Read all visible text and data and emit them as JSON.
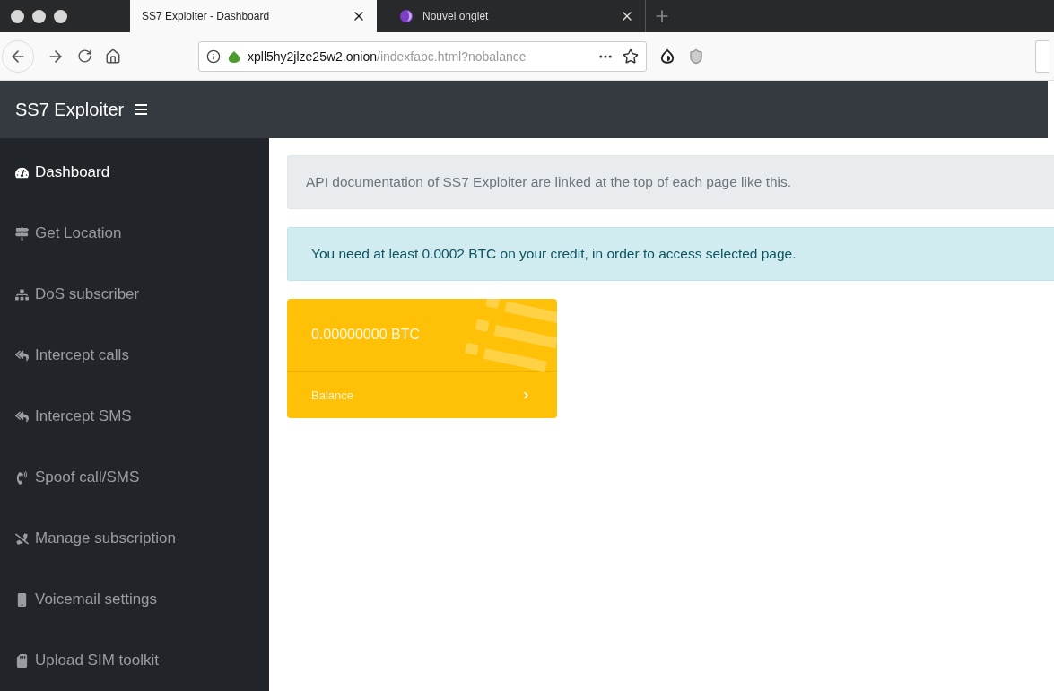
{
  "browser": {
    "tabs": [
      {
        "title": "SS7 Exploiter - Dashboard",
        "selected": true
      },
      {
        "title": "Nouvel onglet",
        "selected": false
      }
    ],
    "url": {
      "host": "xpll5hy2jlze25w2.onion",
      "path": "/indexfabc.html?nobalance"
    }
  },
  "navbar": {
    "brand": "SS7 Exploiter"
  },
  "sidebar": {
    "items": [
      {
        "label": "Dashboard",
        "selected": true
      },
      {
        "label": "Get Location",
        "selected": false
      },
      {
        "label": "DoS subscriber",
        "selected": false
      },
      {
        "label": "Intercept calls",
        "selected": false
      },
      {
        "label": "Intercept SMS",
        "selected": false
      },
      {
        "label": "Spoof call/SMS",
        "selected": false
      },
      {
        "label": "Manage subscription",
        "selected": false
      },
      {
        "label": "Voicemail settings",
        "selected": false
      },
      {
        "label": "Upload SIM toolkit",
        "selected": false
      }
    ]
  },
  "alerts": [
    {
      "kind": "secondary",
      "text": "API documentation of SS7 Exploiter are linked at the top of each page like this."
    },
    {
      "kind": "info",
      "text": "You need at least 0.0002 BTC on your credit, in order to access selected page."
    }
  ],
  "balance_card": {
    "amount": "0.00000000 BTC",
    "footer": "Balance"
  }
}
